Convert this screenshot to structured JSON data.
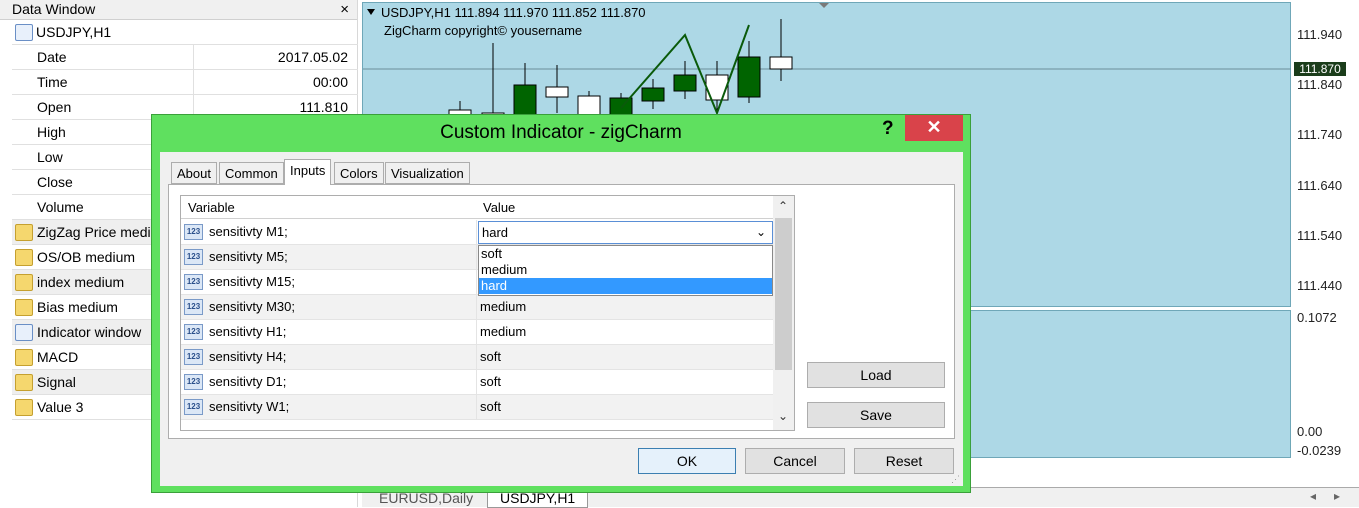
{
  "data_window": {
    "title": "Data Window",
    "close": "×",
    "symbol": "USDJPY,H1",
    "rows": [
      {
        "label": "Date",
        "value": "2017.05.02"
      },
      {
        "label": "Time",
        "value": "00:00"
      },
      {
        "label": "Open",
        "value": "111.810"
      },
      {
        "label": "High",
        "value": ""
      },
      {
        "label": "Low",
        "value": ""
      },
      {
        "label": "Close",
        "value": ""
      },
      {
        "label": "Volume",
        "value": ""
      }
    ],
    "indicators": [
      {
        "label": "ZigZag Price medium",
        "icon": "function-icon"
      },
      {
        "label": "OS/OB medium",
        "icon": "function-icon"
      },
      {
        "label": "index medium",
        "icon": "function-icon"
      },
      {
        "label": "Bias medium",
        "icon": "function-icon"
      },
      {
        "label": "Indicator window",
        "icon": "window-icon"
      },
      {
        "label": "MACD",
        "icon": "function-icon"
      },
      {
        "label": "Signal",
        "icon": "function-icon"
      },
      {
        "label": "Value 3",
        "icon": "function-icon"
      }
    ]
  },
  "chart": {
    "header": "USDJPY,H1  111.894 111.970 111.852 111.870",
    "subheader": "ZigCharm copyright© yousername",
    "current_price": "111.870",
    "price_ticks": [
      "111.940",
      "111.840",
      "111.740",
      "111.640",
      "111.540",
      "111.440"
    ],
    "sub_ticks": [
      "0.1072",
      "0.00",
      "-0.0239"
    ],
    "bottom_tabs": [
      "EURUSD,Daily",
      "USDJPY,H1"
    ],
    "bull_color": "#006400",
    "bear_color": "#ffffff"
  },
  "dialog": {
    "title": "Custom Indicator - zigCharm",
    "help": "?",
    "close": "✕",
    "tabs": [
      "About",
      "Common",
      "Inputs",
      "Colors",
      "Visualization"
    ],
    "active_tab": "Inputs",
    "grid": {
      "col_variable": "Variable",
      "col_value": "Value",
      "rows": [
        {
          "name": "sensitivty M1;",
          "value": "hard"
        },
        {
          "name": "sensitivty M5;",
          "value": ""
        },
        {
          "name": "sensitivty M15;",
          "value": ""
        },
        {
          "name": "sensitivty M30;",
          "value": "medium"
        },
        {
          "name": "sensitivty H1;",
          "value": "medium"
        },
        {
          "name": "sensitivty H4;",
          "value": "soft"
        },
        {
          "name": "sensitivty D1;",
          "value": "soft"
        },
        {
          "name": "sensitivty W1;",
          "value": "soft"
        }
      ],
      "icon_text": "123",
      "dropdown_value": "hard",
      "dropdown_options": [
        "soft",
        "medium",
        "hard"
      ],
      "dropdown_selected": "hard"
    },
    "buttons": {
      "load": "Load",
      "save": "Save",
      "ok": "OK",
      "cancel": "Cancel",
      "reset": "Reset"
    }
  }
}
